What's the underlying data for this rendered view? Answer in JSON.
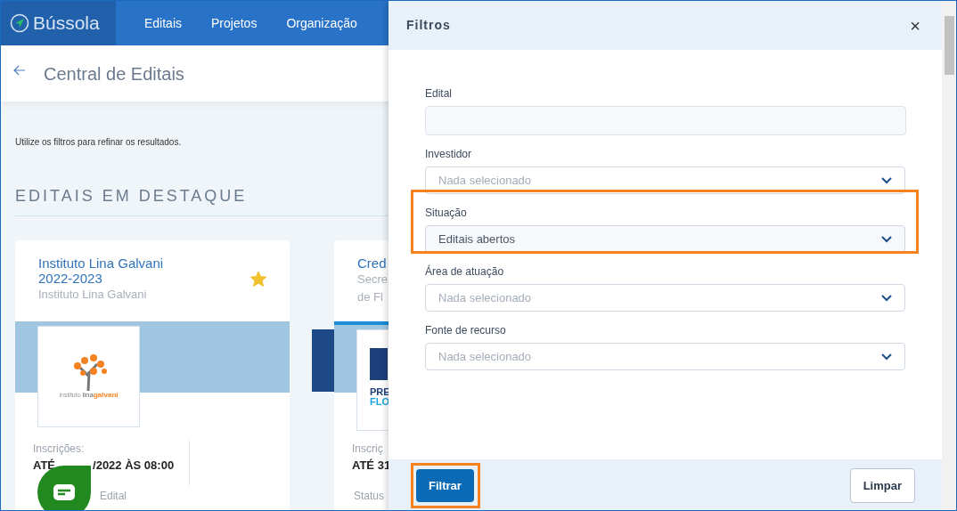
{
  "navbar": {
    "brand": "Bússola",
    "links": [
      {
        "label": "Editais"
      },
      {
        "label": "Projetos"
      },
      {
        "label": "Organização"
      }
    ]
  },
  "page": {
    "title": "Central de Editais",
    "hint": "Utilize os filtros para refinar os resultados.",
    "section_title": "EDITAIS EM DESTAQUE"
  },
  "cards": [
    {
      "title_lines": [
        "Instituto Lina Galvani",
        "2022-2023"
      ],
      "subtitle_lines": [
        "Instituto Lina Galvani"
      ],
      "starred": true,
      "logo_texts": [
        "instituto",
        "lina",
        "galvani"
      ],
      "registration_label": "Inscrições:",
      "registration_parts": [
        "ATÉ",
        "/2022 ÀS 08:00"
      ],
      "status_label": "Edital"
    },
    {
      "title_lines": [
        "Cred"
      ],
      "subtitle_lines": [
        "Secre",
        "de Fl"
      ],
      "logo_texts": [
        "PRE",
        "FLO"
      ],
      "registration_label": "Inscriç",
      "registration_parts": [
        "ATÉ 31"
      ],
      "status_label": "Status"
    }
  ],
  "filters": {
    "title": "Filtros",
    "close": "×",
    "fields": [
      {
        "kind": "text",
        "label": "Edital"
      },
      {
        "kind": "select",
        "label": "Investidor",
        "placeholder": "Nada selecionado"
      },
      {
        "kind": "select",
        "label": "Situação",
        "value": "Editais abertos",
        "highlighted": true
      },
      {
        "kind": "select",
        "label": "Área de atuação",
        "placeholder": "Nada selecionado"
      },
      {
        "kind": "select",
        "label": "Fonte de recurso",
        "placeholder": "Nada selecionado"
      }
    ],
    "buttons": [
      {
        "label": "Filtrar",
        "kind": "primary",
        "highlighted": true
      },
      {
        "label": "Limpar",
        "kind": "outline"
      }
    ]
  }
}
